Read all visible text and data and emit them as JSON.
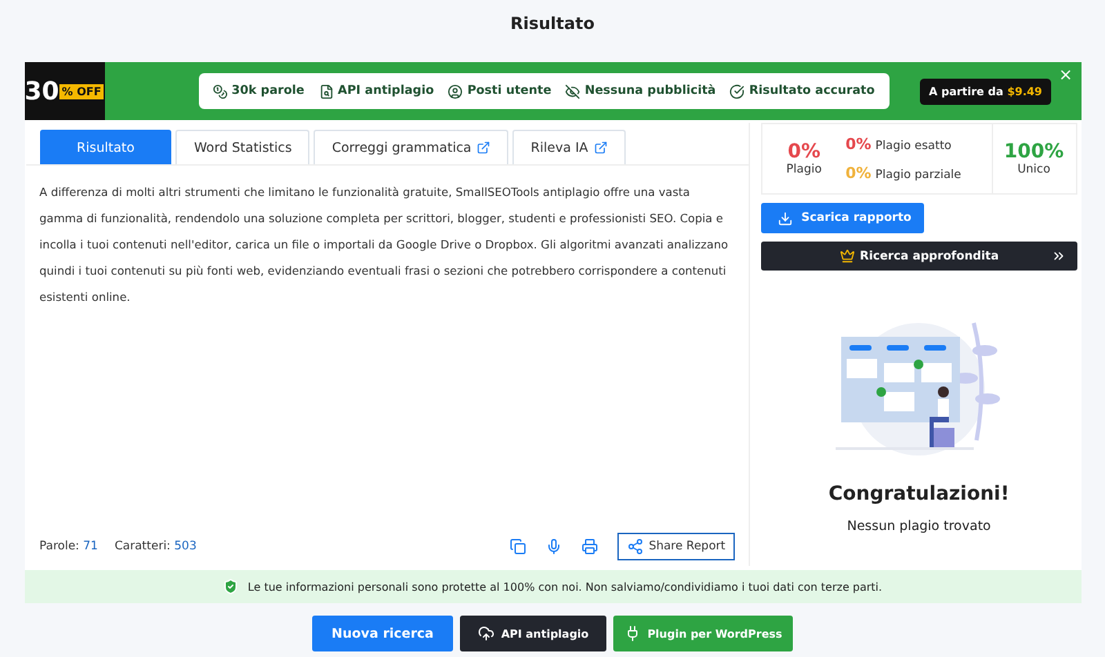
{
  "page_title": "Risultato",
  "banner": {
    "discount_number": "30",
    "discount_suffix": "% OFF",
    "features": [
      {
        "label": "30k parole"
      },
      {
        "label": "API antiplagio"
      },
      {
        "label": "Posti utente"
      },
      {
        "label": "Nessuna pubblicità"
      },
      {
        "label": "Risultato accurato"
      }
    ],
    "price_label": "A partire da",
    "price": "$9.49",
    "close": "×"
  },
  "tabs": [
    {
      "label": "Risultato",
      "selected": true,
      "external": false
    },
    {
      "label": "Word Statistics",
      "selected": false,
      "external": false
    },
    {
      "label": "Correggi grammatica",
      "selected": false,
      "external": true
    },
    {
      "label": "Rileva IA",
      "selected": false,
      "external": true
    }
  ],
  "text": "A differenza di molti altri strumenti che limitano le funzionalità gratuite, SmallSEOTools antiplagio offre una vasta gamma di funzionalità, rendendolo una soluzione completa per scrittori, blogger, studenti e professionisti SEO. Copia e incolla i tuoi contenuti nell'editor, carica un file o importali da Google Drive o Dropbox. Gli algoritmi avanzati analizzano quindi i tuoi contenuti su più fonti web, evidenziando eventuali frasi o sezioni che potrebbero corrispondere a contenuti esistenti online.",
  "counts": [
    {
      "label": "Parole:",
      "value": "71"
    },
    {
      "label": "Caratteri:",
      "value": "503"
    }
  ],
  "share_button": "Share Report",
  "stats": {
    "plagio_value": "0%",
    "plagio_label": "Plagio",
    "exact_value": "0%",
    "exact_label": "Plagio esatto",
    "partial_value": "0%",
    "partial_label": "Plagio parziale",
    "unique_value": "100%",
    "unique_label": "Unico"
  },
  "download_button": "Scarica rapporto",
  "deep_search_button": "Ricerca approfondita",
  "result_title": "Congratulazioni!",
  "result_subtitle": "Nessun plagio trovato",
  "privacy_note": "Le tue informazioni personali sono protette al 100% con noi. Non salviamo/condividiamo i tuoi dati con terze parti.",
  "actions": [
    {
      "kind": "primary",
      "label": "Nuova ricerca"
    },
    {
      "kind": "dark",
      "label": "API antiplagio"
    },
    {
      "kind": "green",
      "label": "Plugin per WordPress"
    }
  ]
}
